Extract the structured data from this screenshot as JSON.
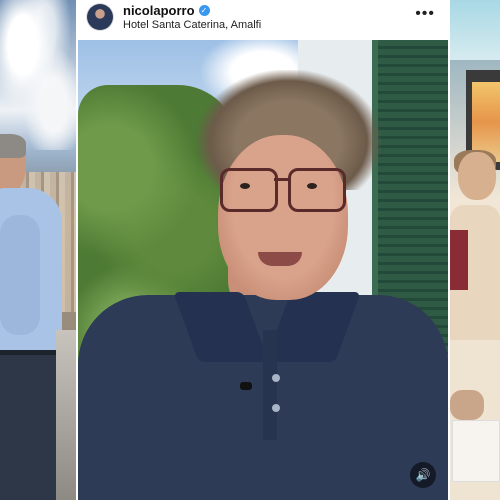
{
  "post": {
    "username": "nicolaporro",
    "location": "Hotel Santa Caterina, Amalfi",
    "verified_icon": "verified-badge-icon",
    "more_icon": "more-options-icon",
    "more_glyph": "•••",
    "sound_icon": "speaker-icon",
    "sound_glyph": "🔊"
  },
  "colors": {
    "verified": "#3897f0",
    "shutter_green": "#2f5a43",
    "shirt_navy": "#2d3b57"
  }
}
